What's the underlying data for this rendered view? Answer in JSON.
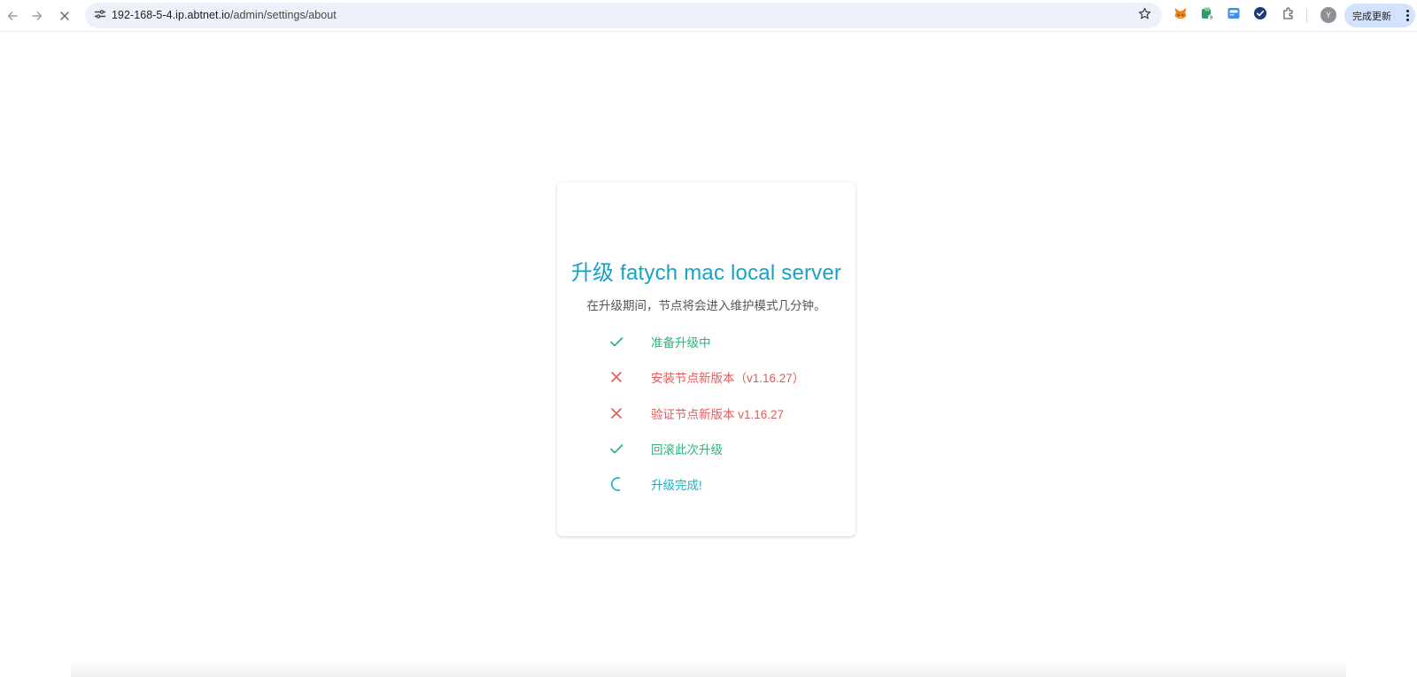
{
  "browser": {
    "url_host": "192-168-5-4.ip.abtnet.io",
    "url_path": "/admin/settings/about",
    "profile_initial": "Y",
    "update_button_label": "完成更新",
    "extensions": [
      "fox-icon",
      "wallet-icon",
      "card-icon",
      "check-badge-icon",
      "puzzle-icon"
    ]
  },
  "upgrade": {
    "title": "升级 fatych mac local server",
    "subtitle": "在升级期间，节点将会进入维护模式几分钟。",
    "steps": [
      {
        "label": "准备升级中",
        "status": "done"
      },
      {
        "label": "安装节点新版本（v1.16.27）",
        "status": "failed"
      },
      {
        "label": "验证节点新版本 v1.16.27",
        "status": "failed"
      },
      {
        "label": "回滚此次升级",
        "status": "done"
      },
      {
        "label": "升级完成!",
        "status": "in-progress"
      }
    ]
  },
  "colors": {
    "title": "#17a2c6",
    "success": "#2fb37a",
    "error": "#e05b5b",
    "progress": "#16b3c8"
  }
}
